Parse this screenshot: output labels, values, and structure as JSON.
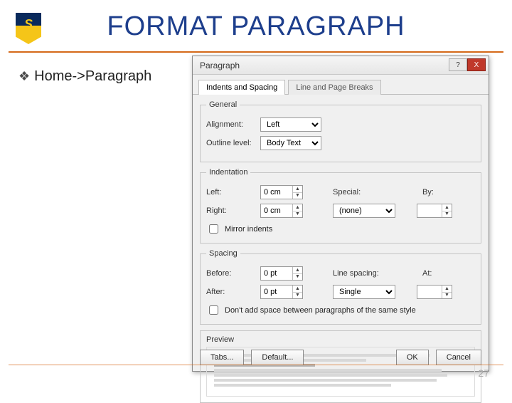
{
  "slide": {
    "title": "FORMAT PARAGRAPH",
    "bullet": "Home->Paragraph",
    "page_number": "27"
  },
  "dialog": {
    "title": "Paragraph",
    "help_icon": "?",
    "close_icon": "X",
    "tabs": {
      "active": "Indents and Spacing",
      "other": "Line and Page Breaks"
    },
    "general": {
      "legend": "General",
      "alignment_label": "Alignment:",
      "alignment_value": "Left",
      "outline_label": "Outline level:",
      "outline_value": "Body Text"
    },
    "indent": {
      "legend": "Indentation",
      "left_label": "Left:",
      "left_value": "0 cm",
      "right_label": "Right:",
      "right_value": "0 cm",
      "special_label": "Special:",
      "special_value": "(none)",
      "by_label": "By:",
      "by_value": "",
      "mirror_label": "Mirror indents"
    },
    "spacing": {
      "legend": "Spacing",
      "before_label": "Before:",
      "before_value": "0 pt",
      "after_label": "After:",
      "after_value": "0 pt",
      "line_label": "Line spacing:",
      "line_value": "Single",
      "at_label": "At:",
      "at_value": "",
      "noadd_label": "Don't add space between paragraphs of the same style"
    },
    "preview": {
      "legend": "Preview"
    },
    "buttons": {
      "tabs": "Tabs...",
      "default": "Default...",
      "ok": "OK",
      "cancel": "Cancel"
    }
  }
}
